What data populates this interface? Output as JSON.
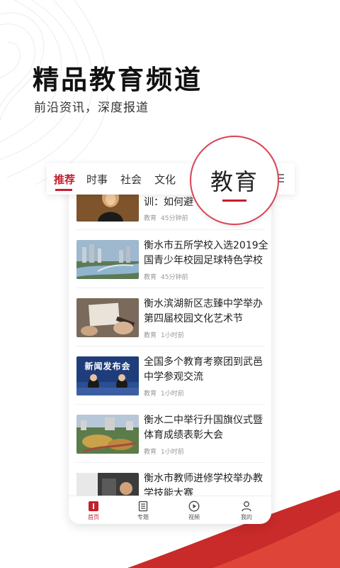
{
  "header": {
    "title": "精品教育频道",
    "subtitle": "前沿资讯，深度报道"
  },
  "tabs": [
    {
      "label": "推荐",
      "active": true
    },
    {
      "label": "时事",
      "active": false
    },
    {
      "label": "社会",
      "active": false
    },
    {
      "label": "文化",
      "active": false
    }
  ],
  "zoom_label": "教育",
  "news": [
    {
      "title": "训：如何避",
      "category": "教育",
      "time": "45分钟前"
    },
    {
      "title": "衡水市五所学校入选2019全国青少年校园足球特色学校",
      "category": "教育",
      "time": "45分钟前"
    },
    {
      "title": "衡水滨湖新区志臻中学举办第四届校园文化艺术节",
      "category": "教育",
      "time": "1小时前"
    },
    {
      "title": "全国多个教育考察团到武邑中学参观交流",
      "category": "教育",
      "time": "1小时前",
      "thumb_text": "新闻发布会"
    },
    {
      "title": "衡水二中举行升国旗仪式暨体育成绩表彰大会",
      "category": "教育",
      "time": "1小时前"
    },
    {
      "title": "衡水市教师进修学校举办教学技能大赛",
      "category": "",
      "time": ""
    }
  ],
  "bottom_nav": [
    {
      "label": "首页",
      "icon": "home-icon",
      "active": true
    },
    {
      "label": "专题",
      "icon": "document-icon",
      "active": false
    },
    {
      "label": "视频",
      "icon": "play-icon",
      "active": false
    },
    {
      "label": "我的",
      "icon": "user-icon",
      "active": false
    }
  ],
  "colors": {
    "accent": "#c3202e",
    "swoosh": "#d83a3a"
  }
}
